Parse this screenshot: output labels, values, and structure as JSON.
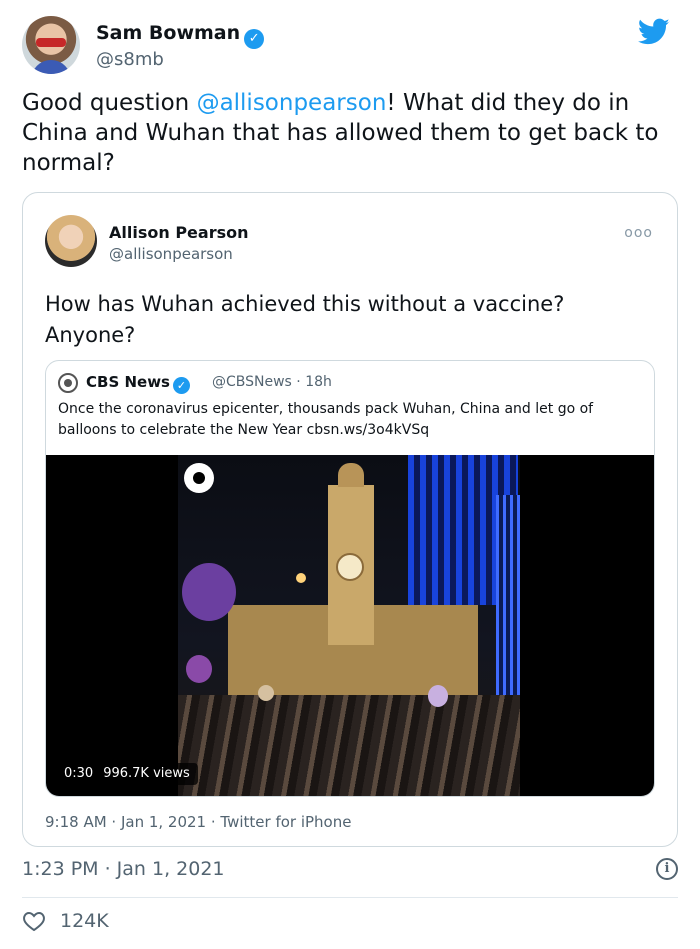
{
  "author": {
    "name": "Sam Bowman",
    "handle": "@s8mb"
  },
  "tweet": {
    "text_before": "Good question ",
    "mention": "@allisonpearson",
    "text_after": "! What did they do in China and Wuhan that has allowed them to get back to normal?",
    "timestamp": "1:23 PM · Jan 1, 2021",
    "likes": "124K"
  },
  "quoted": {
    "name": "Allison Pearson",
    "handle": "@allisonpearson",
    "more": "ooo",
    "text": "How has Wuhan achieved this without a vaccine? Anyone?",
    "timestamp": "9:18 AM · Jan 1, 2021 · Twitter for iPhone",
    "embedded": {
      "name": "CBS News",
      "meta": "@CBSNews · 18h",
      "text": "Once the coronavirus epicenter, thousands pack Wuhan, China and let go of balloons to celebrate the New Year cbsn.ws/3o4kVSq",
      "video": {
        "duration": "0:30",
        "views": "996.7K views"
      }
    }
  },
  "icons": {
    "verified": "verified-badge-icon",
    "twitter": "twitter-bird-icon",
    "info": "info-icon",
    "like": "heart-icon"
  },
  "colors": {
    "accent": "#1d9bf0",
    "text": "#0f1419",
    "secondary": "#536471",
    "border": "#cfd9de"
  }
}
